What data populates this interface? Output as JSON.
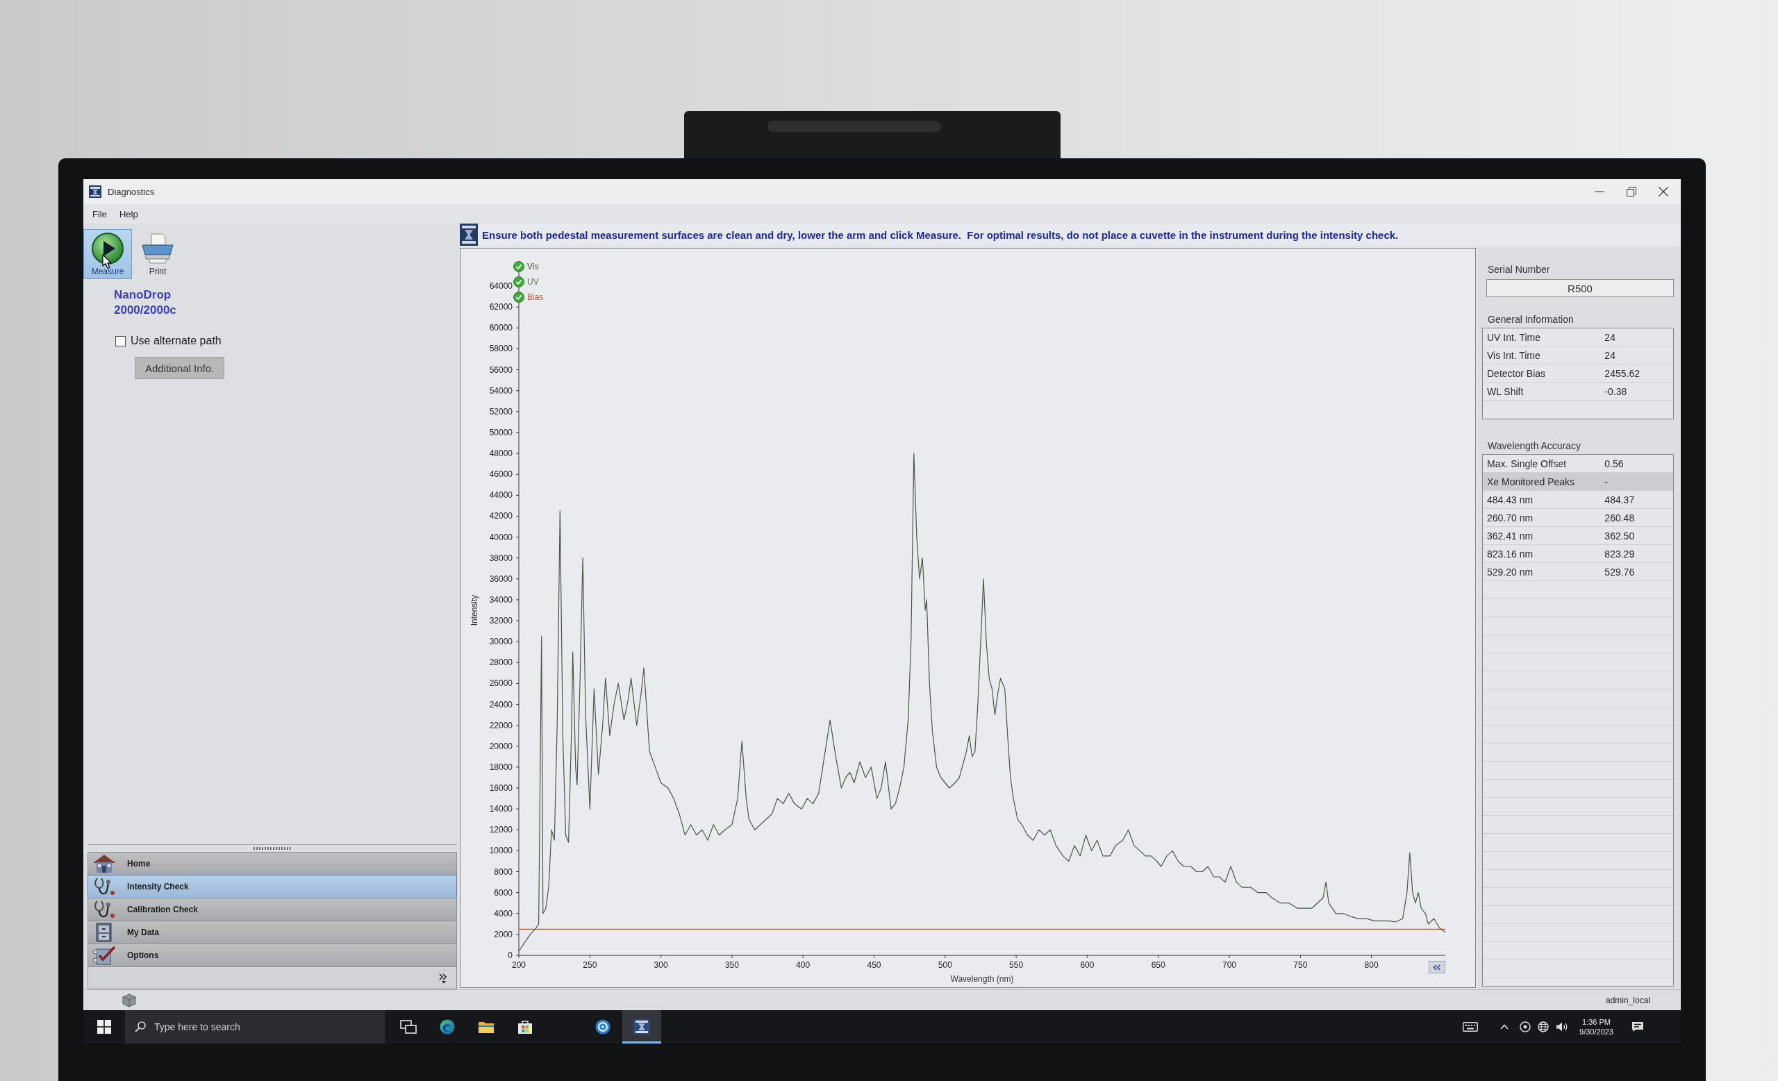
{
  "window": {
    "title": "Diagnostics"
  },
  "menu": [
    {
      "label": "File"
    },
    {
      "label": "Help"
    }
  ],
  "toolbar": [
    {
      "label": "Measure",
      "kind": "measure",
      "highlighted": true
    },
    {
      "label": "Print",
      "kind": "print",
      "highlighted": false
    }
  ],
  "product_name": [
    "NanoDrop",
    "2000/2000c"
  ],
  "alternate_path": {
    "label": "Use alternate path",
    "checked": false
  },
  "additional_info_button": {
    "label": "Additional Info."
  },
  "navigation": [
    {
      "label": "Home",
      "kind": "home",
      "selected": false
    },
    {
      "label": "Intensity Check",
      "kind": "intensity",
      "selected": true
    },
    {
      "label": "Calibration Check",
      "kind": "calibration",
      "selected": false
    },
    {
      "label": "My Data",
      "kind": "data",
      "selected": false
    },
    {
      "label": "Options",
      "kind": "options",
      "selected": false
    }
  ],
  "instruction": "Ensure both pedestal measurement surfaces are clean and dry, lower the arm and click Measure.  For optimal results, do not place a cuvette in the instrument during the intensity check.",
  "chart": {
    "legend": [
      {
        "kind": "series",
        "checked": true
      },
      {
        "kind": "label",
        "label": "UV",
        "color": "#5d7258",
        "checked": true
      },
      {
        "kind": "series",
        "checked": true
      }
    ],
    "chart_data": {
      "type": "line",
      "xlabel": "Wavelength (nm)",
      "ylabel": "Intensity",
      "x": [
        200,
        204,
        208,
        212,
        214,
        216,
        217,
        219,
        221,
        223,
        225,
        227,
        229,
        231,
        233,
        235,
        237,
        238,
        240,
        241,
        243,
        245,
        247,
        250,
        253,
        256,
        259,
        261,
        264,
        267,
        270,
        274,
        277,
        279,
        283,
        286,
        288,
        292,
        296,
        300,
        305,
        309,
        313,
        317,
        321,
        325,
        329,
        333,
        337,
        341,
        345,
        350,
        354,
        357,
        360,
        362,
        366,
        370,
        374,
        378,
        382,
        386,
        390,
        394,
        399,
        403,
        407,
        411,
        415,
        419,
        423,
        427,
        430,
        433,
        436,
        440,
        444,
        448,
        452,
        455,
        458,
        462,
        465,
        468,
        471,
        474,
        476,
        478,
        480,
        482,
        484,
        486,
        487,
        489,
        491,
        494,
        497,
        500,
        503,
        507,
        510,
        513,
        515,
        517,
        519,
        521,
        523,
        525,
        527,
        529,
        531,
        533,
        535,
        537,
        539,
        542,
        544,
        546,
        548,
        551,
        554,
        558,
        562,
        566,
        570,
        574,
        578,
        583,
        587,
        591,
        595,
        599,
        603,
        607,
        611,
        616,
        620,
        625,
        629,
        633,
        637,
        641,
        645,
        649,
        652,
        656,
        660,
        664,
        668,
        673,
        677,
        681,
        685,
        689,
        693,
        697,
        701,
        705,
        709,
        715,
        720,
        726,
        730,
        736,
        742,
        748,
        754,
        758,
        762,
        766,
        768,
        770,
        775,
        780,
        786,
        791,
        797,
        802,
        807,
        812,
        817,
        822,
        825,
        827,
        829,
        831,
        833,
        835,
        838,
        840,
        844,
        848,
        852
      ],
      "series": [
        {
          "name": "Vis",
          "color": "#4a5548",
          "values": [
            400,
            1200,
            2000,
            2600,
            3000,
            30500,
            4000,
            4500,
            6500,
            12000,
            11000,
            22000,
            42500,
            21000,
            11500,
            10800,
            21000,
            29000,
            18000,
            16300,
            26000,
            38000,
            23000,
            14000,
            25500,
            17300,
            22000,
            26500,
            21000,
            24000,
            26000,
            22500,
            24500,
            26500,
            22000,
            25000,
            27500,
            19500,
            18000,
            16500,
            16000,
            15000,
            13500,
            11500,
            12500,
            11500,
            12000,
            11000,
            12500,
            11500,
            12000,
            12500,
            15000,
            20500,
            15000,
            13000,
            12000,
            12500,
            13000,
            13500,
            15000,
            14500,
            15500,
            14500,
            14000,
            15000,
            14500,
            15500,
            19000,
            22500,
            19000,
            16000,
            17000,
            17500,
            16500,
            18500,
            17000,
            18000,
            15000,
            16000,
            18500,
            14000,
            14500,
            16000,
            18000,
            22500,
            30000,
            48000,
            40000,
            36000,
            38000,
            33000,
            34000,
            26000,
            21500,
            18000,
            17000,
            16500,
            16000,
            16500,
            17000,
            18500,
            19500,
            21000,
            19000,
            19500,
            24000,
            30000,
            36000,
            30000,
            26500,
            25500,
            23000,
            25000,
            26500,
            25500,
            21000,
            17000,
            15000,
            13000,
            12500,
            11500,
            11000,
            12000,
            11500,
            12000,
            10500,
            9500,
            9000,
            10500,
            9500,
            11500,
            10000,
            11000,
            9500,
            9500,
            10500,
            11000,
            12000,
            10500,
            10000,
            9500,
            9500,
            9000,
            8500,
            9500,
            10000,
            9000,
            8500,
            8500,
            8000,
            8000,
            8500,
            7500,
            7500,
            7000,
            8500,
            7000,
            6500,
            6500,
            6000,
            6000,
            5500,
            5000,
            5000,
            4500,
            4500,
            4500,
            5000,
            5500,
            7000,
            5000,
            4000,
            4000,
            3700,
            3500,
            3500,
            3300,
            3300,
            3300,
            3200,
            3500,
            6000,
            9800,
            6000,
            5000,
            6000,
            4500,
            4000,
            3000,
            3500,
            2600,
            2200
          ]
        },
        {
          "name": "Bias",
          "color": "#c0583a",
          "values": [
            2500,
            2500,
            2500,
            2500,
            2500,
            2500,
            2500,
            2500,
            2500,
            2500,
            2500,
            2500,
            2500,
            2500,
            2500,
            2500,
            2500,
            2500,
            2500,
            2500,
            2500,
            2500,
            2500,
            2500,
            2500,
            2500,
            2500,
            2500,
            2500,
            2500,
            2500,
            2500,
            2500,
            2500,
            2500,
            2500,
            2500,
            2500,
            2500,
            2500,
            2500,
            2500,
            2500,
            2500,
            2500,
            2500,
            2500,
            2500,
            2500,
            2500,
            2500,
            2500,
            2500,
            2500,
            2500,
            2500,
            2500,
            2500,
            2500,
            2500,
            2500,
            2500,
            2500,
            2500,
            2500,
            2500,
            2500,
            2500,
            2500,
            2500,
            2500,
            2500,
            2500,
            2500,
            2500,
            2500,
            2500,
            2500,
            2500,
            2500,
            2500,
            2500,
            2500,
            2500,
            2500,
            2500,
            2500,
            2500,
            2500,
            2500,
            2500,
            2500,
            2500,
            2500,
            2500,
            2500,
            2500,
            2500,
            2500,
            2500,
            2500,
            2500,
            2500,
            2500,
            2500,
            2500,
            2500,
            2500,
            2500,
            2500,
            2500,
            2500,
            2500,
            2500,
            2500,
            2500,
            2500,
            2500,
            2500,
            2500,
            2500,
            2500,
            2500,
            2500,
            2500,
            2500,
            2500,
            2500,
            2500,
            2500,
            2500,
            2500,
            2500,
            2500,
            2500,
            2500,
            2500,
            2500,
            2500,
            2500,
            2500,
            2500,
            2500,
            2500,
            2500,
            2500,
            2500,
            2500,
            2500,
            2500,
            2500,
            2500,
            2500,
            2500,
            2500,
            2500,
            2500,
            2500,
            2500,
            2500,
            2500,
            2500,
            2500,
            2500,
            2500,
            2500,
            2500,
            2500,
            2500,
            2500,
            2500,
            2500,
            2500,
            2500,
            2500,
            2500,
            2500,
            2500,
            2500,
            2500,
            2500,
            2500,
            2500,
            2500,
            2500,
            2500,
            2500,
            2500,
            2500,
            2500,
            2500,
            2500,
            2500
          ]
        }
      ],
      "xlim": [
        200,
        852
      ],
      "ylim": [
        0,
        66000
      ],
      "xticks": [
        200,
        250,
        300,
        350,
        400,
        450,
        500,
        550,
        600,
        650,
        700,
        750,
        800
      ],
      "yticks": [
        0,
        2000,
        4000,
        6000,
        8000,
        10000,
        12000,
        14000,
        16000,
        18000,
        20000,
        22000,
        24000,
        26000,
        28000,
        30000,
        32000,
        34000,
        36000,
        38000,
        40000,
        42000,
        44000,
        46000,
        48000,
        50000,
        52000,
        54000,
        56000,
        58000,
        60000,
        62000,
        64000
      ]
    }
  },
  "serial_number": {
    "label": "Serial Number",
    "value": "R500"
  },
  "general_information": {
    "title": "General Information",
    "rows": [
      {
        "label": "UV Int. Time",
        "value": "24"
      },
      {
        "label": "Vis Int. Time",
        "value": "24"
      },
      {
        "label": "Detector Bias",
        "value": "2455.62"
      },
      {
        "label": "WL Shift",
        "value": "-0.38"
      }
    ]
  },
  "wavelength_accuracy": {
    "title": "Wavelength Accuracy",
    "rows": [
      {
        "kind": "value",
        "label": "Max. Single Offset",
        "value": "0.56"
      },
      {
        "kind": "section",
        "label": "Xe Monitored Peaks",
        "value": "-"
      },
      {
        "kind": "value",
        "label": "484.43 nm",
        "value": "484.37"
      },
      {
        "kind": "value",
        "label": "260.70 nm",
        "value": "260.48"
      },
      {
        "kind": "value",
        "label": "362.41 nm",
        "value": "362.50"
      },
      {
        "kind": "value",
        "label": "823.16 nm",
        "value": "823.29"
      },
      {
        "kind": "value",
        "label": "529.20 nm",
        "value": "529.76"
      }
    ]
  },
  "status_bar": {
    "user": "admin_local"
  },
  "taskbar": {
    "search": {
      "placeholder": "Type here to search"
    },
    "apps": [
      {
        "kind": "task-view",
        "active": false
      },
      {
        "kind": "browser",
        "active": false
      },
      {
        "kind": "files",
        "active": false
      },
      {
        "kind": "store",
        "active": false
      },
      {
        "kind": "ring",
        "active": false
      },
      {
        "kind": "instrument",
        "active": true
      }
    ],
    "time": "1:36 PM",
    "date": "9/30/2023"
  }
}
